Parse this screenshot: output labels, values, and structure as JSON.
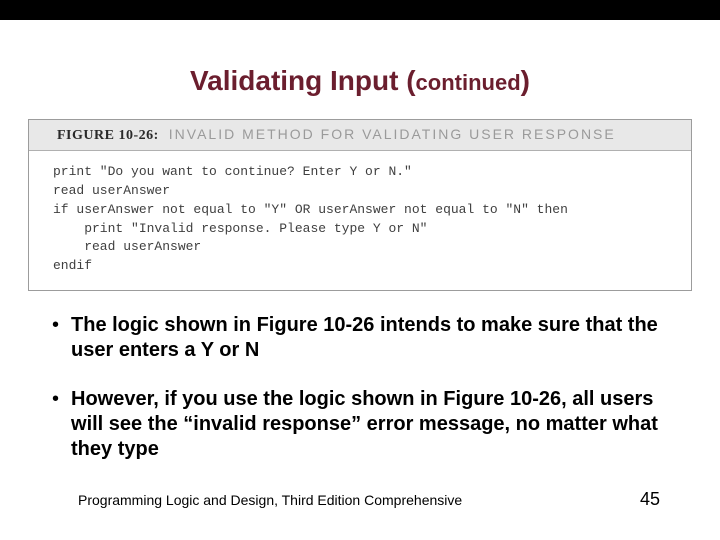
{
  "title": {
    "main": "Validating Input (",
    "continued": "continued",
    "closing": ")"
  },
  "figure": {
    "label": "FIGURE 10-26:",
    "caption": "INVALID METHOD FOR VALIDATING USER RESPONSE",
    "code": "print \"Do you want to continue? Enter Y or N.\"\nread userAnswer\nif userAnswer not equal to \"Y\" OR userAnswer not equal to \"N\" then\n    print \"Invalid response. Please type Y or N\"\n    read userAnswer\nendif"
  },
  "bullets": [
    "The logic shown in Figure 10-26 intends to make sure that the user enters a Y or N",
    "However, if you use the logic shown in Figure 10-26, all users will see the “invalid response” error message, no matter what they type"
  ],
  "footer": {
    "left": "Programming Logic and Design, Third Edition Comprehensive",
    "page": "45"
  }
}
